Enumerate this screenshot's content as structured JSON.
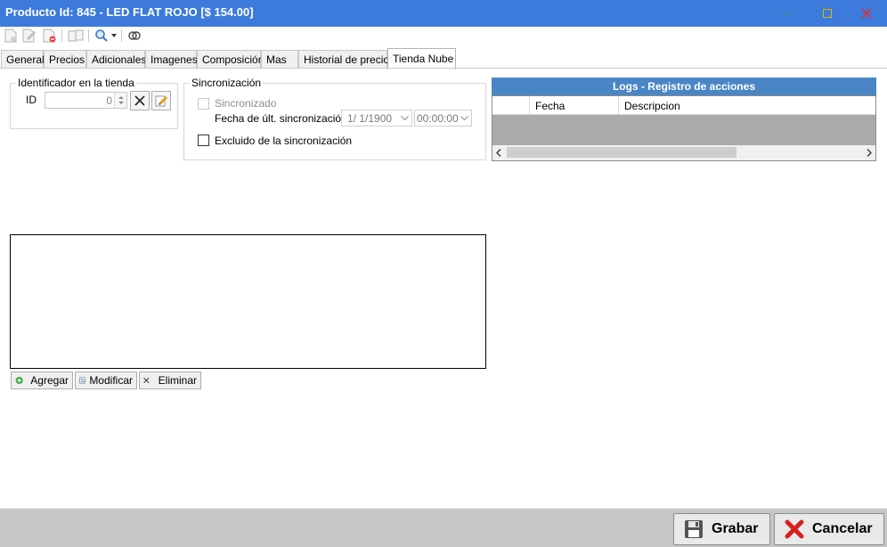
{
  "colors": {
    "accent": "#3c7bdc",
    "logs_header": "#4a86c6",
    "grid_bg": "#aaaaaa",
    "bottom_bar": "#c6c6c6"
  },
  "window": {
    "title": "Producto Id: 845 - LED FLAT ROJO [$ 154.00]"
  },
  "toolbar": {
    "icons": [
      "new-doc-icon",
      "edit-doc-icon",
      "delete-doc-icon",
      "copy-icon",
      "search-icon",
      "link-icon"
    ]
  },
  "tabs": [
    {
      "label": "General"
    },
    {
      "label": "Precios"
    },
    {
      "label": "Adicionales"
    },
    {
      "label": "Imagenes"
    },
    {
      "label": "Composición"
    },
    {
      "label": "Mas"
    },
    {
      "label": "Historial de precios"
    },
    {
      "label": "Tienda Nube",
      "active": true
    }
  ],
  "store_id_group": {
    "title": "Identificador en la tienda",
    "id_label": "ID",
    "id_value": "0"
  },
  "sync_group": {
    "title": "Sincronización",
    "synced_label": "Sincronizado",
    "synced_checked": false,
    "last_sync_label": "Fecha de últ. sincronización",
    "last_sync_date": "1/  1/1900",
    "last_sync_time": "00:00:00",
    "excluded_label": "Excluido de la sincronización",
    "excluded_checked": false
  },
  "logs": {
    "title": "Logs - Registro de acciones",
    "columns": [
      "",
      "Fecha",
      "Descripcion"
    ]
  },
  "list_actions": {
    "add_label": "Agregar",
    "modify_label": "Modificar",
    "delete_label": "Eliminar"
  },
  "footer": {
    "save_label": "Grabar",
    "cancel_label": "Cancelar"
  }
}
